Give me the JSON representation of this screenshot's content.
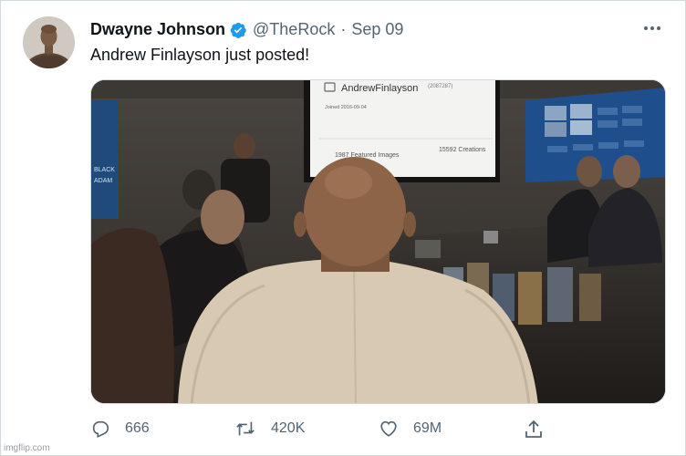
{
  "tweet": {
    "author_name": "Dwayne Johnson",
    "handle": "@TheRock",
    "separator": "·",
    "date": "Sep 09",
    "text": "Andrew Finlayson just posted!"
  },
  "media": {
    "screen_username": "AndrewFinlayson",
    "screen_user_id": "(2087287)",
    "screen_joined": "Joined 2016-09-04",
    "screen_featured": "1987 Featured Images",
    "screen_creations": "15592 Creations",
    "left_screen_text_1": "BLACK",
    "left_screen_text_2": "ADAM"
  },
  "actions": {
    "replies": "666",
    "retweets": "420K",
    "likes": "69M"
  },
  "watermark": "imgflip.com",
  "colors": {
    "verified": "#1d9bf0",
    "secondary_text": "#536471",
    "border": "#cfd9de"
  }
}
